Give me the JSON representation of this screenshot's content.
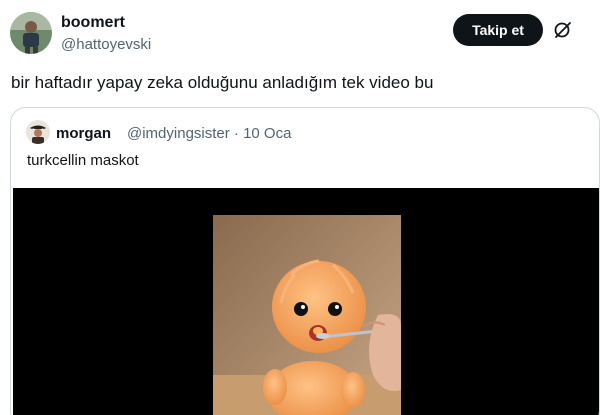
{
  "tweet": {
    "author_name": "boomert",
    "author_handle": "@hattoyevski",
    "follow_label": "Takip et",
    "text": "bir haftadır yapay zeka olduğunu anladığım tek video bu"
  },
  "quoted": {
    "author_name": "morgan",
    "meta": "@imdyingsister · 10 Oca",
    "text": "turkcellin maskot"
  },
  "icons": {
    "more": "grok-icon"
  },
  "colors": {
    "text_primary": "#0f1419",
    "text_secondary": "#536471",
    "button_bg": "#0f1419",
    "border": "#cfd9de",
    "media_bg": "#000000"
  }
}
